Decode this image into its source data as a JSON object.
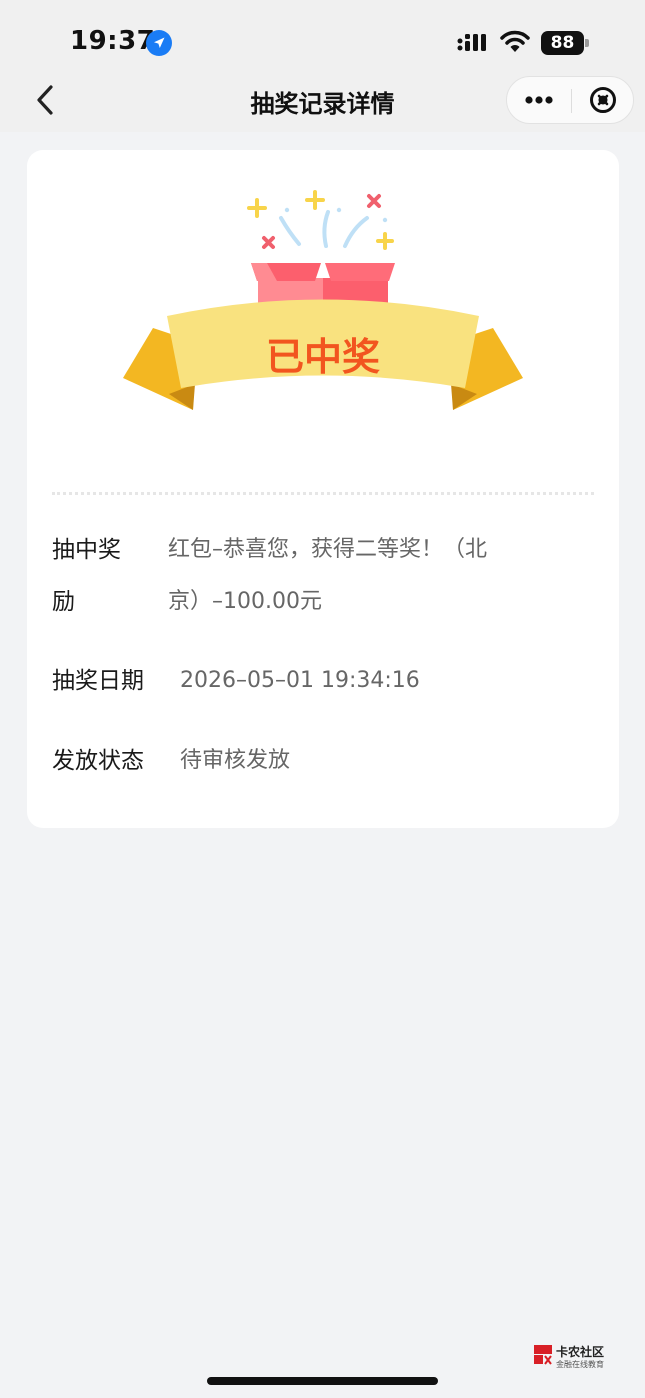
{
  "status_bar": {
    "time": "19:37",
    "battery": "88",
    "icons": [
      "location-arrow-icon",
      "cellular-signal-icon",
      "wifi-icon",
      "battery-icon"
    ]
  },
  "nav": {
    "title": "抽奖记录详情",
    "icons": [
      "back-chevron-icon",
      "more-dots-icon",
      "close-circle-icon"
    ]
  },
  "result": {
    "banner_text": "已中奖",
    "colors": {
      "ribbon": "#f9e27f",
      "ribbon_tail": "#f3b722",
      "box": "#fc5f6d",
      "text": "#f2551f"
    }
  },
  "details": {
    "prize_label_line1": "抽中奖",
    "prize_label_line2": "励",
    "prize_value_line1": "红包–恭喜您，获得二等奖！（北",
    "prize_value_line2": "京）–100.00元",
    "date_label": "抽奖日期",
    "date_value": "2026–05–01 19:34:16",
    "status_label": "发放状态",
    "status_value": "待审核发放"
  },
  "watermark": {
    "title": "卡农社区",
    "subtitle": "金融在线教育"
  }
}
